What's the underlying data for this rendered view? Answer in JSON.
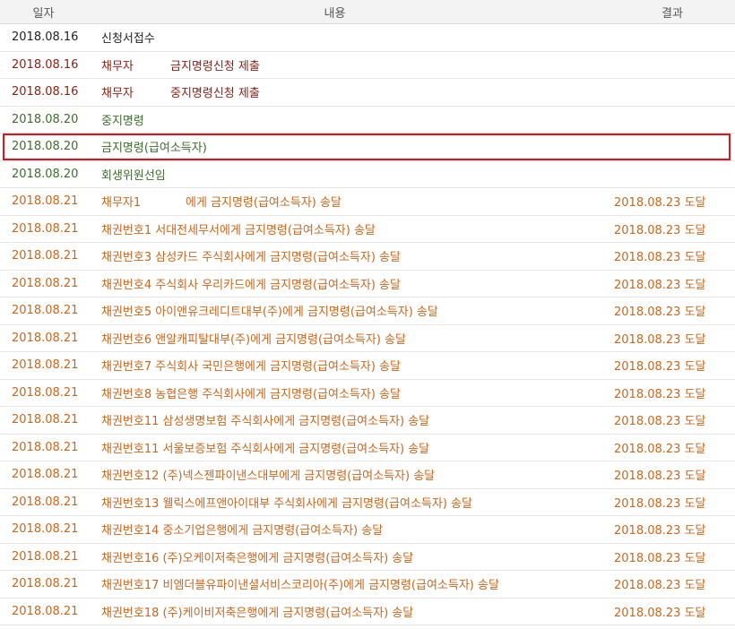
{
  "header": {
    "date": "일자",
    "content": "내용",
    "result": "결과"
  },
  "colors": {
    "black": "#222222",
    "maroon": "#8a1f11",
    "green": "#3f6b2f",
    "orange": "#c8661e",
    "highlight_border": "#e3111a"
  },
  "rows": [
    {
      "date": "2018.08.16",
      "party": "",
      "content": "신청서접수",
      "result": "",
      "color": "#222222",
      "highlight": false
    },
    {
      "date": "2018.08.16",
      "party": "채무자",
      "content": "금지명령신청 제출",
      "result": "",
      "color": "#8a1f11",
      "highlight": false
    },
    {
      "date": "2018.08.16",
      "party": "채무자",
      "content": "중지명령신청 제출",
      "result": "",
      "color": "#8a1f11",
      "highlight": false
    },
    {
      "date": "2018.08.20",
      "party": "",
      "content": "중지명령",
      "result": "",
      "color": "#3f6b2f",
      "highlight": false
    },
    {
      "date": "2018.08.20",
      "party": "",
      "content": "금지명령(급여소득자)",
      "result": "",
      "color": "#3f6b2f",
      "highlight": true
    },
    {
      "date": "2018.08.20",
      "party": "",
      "content": "회생위원선임",
      "result": "",
      "color": "#3f6b2f",
      "highlight": false
    },
    {
      "date": "2018.08.21",
      "party": "채무자1",
      "content": "에게 금지명령(급여소득자) 송달",
      "result": "2018.08.23 도달",
      "color": "#c8661e",
      "highlight": false
    },
    {
      "date": "2018.08.21",
      "party": "",
      "content": "채권번호1 서대전세무서에게 금지명령(급여소득자) 송달",
      "result": "2018.08.23 도달",
      "color": "#c8661e",
      "highlight": false
    },
    {
      "date": "2018.08.21",
      "party": "",
      "content": "채권번호3 삼성카드 주식회사에게 금지명령(급여소득자) 송달",
      "result": "2018.08.23 도달",
      "color": "#c8661e",
      "highlight": false
    },
    {
      "date": "2018.08.21",
      "party": "",
      "content": "채권번호4 주식회사 우리카드에게 금지명령(급여소득자) 송달",
      "result": "2018.08.23 도달",
      "color": "#c8661e",
      "highlight": false
    },
    {
      "date": "2018.08.21",
      "party": "",
      "content": "채권번호5 아이앤유크레디트대부(주)에게 금지명령(급여소득자) 송달",
      "result": "2018.08.23 도달",
      "color": "#c8661e",
      "highlight": false
    },
    {
      "date": "2018.08.21",
      "party": "",
      "content": "채권번호6 앤알캐피탈대부(주)에게 금지명령(급여소득자) 송달",
      "result": "2018.08.23 도달",
      "color": "#c8661e",
      "highlight": false
    },
    {
      "date": "2018.08.21",
      "party": "",
      "content": "채권번호7 주식회사 국민은행에게 금지명령(급여소득자) 송달",
      "result": "2018.08.23 도달",
      "color": "#c8661e",
      "highlight": false
    },
    {
      "date": "2018.08.21",
      "party": "",
      "content": "채권번호8 농협은행 주식회사에게 금지명령(급여소득자) 송달",
      "result": "2018.08.23 도달",
      "color": "#c8661e",
      "highlight": false
    },
    {
      "date": "2018.08.21",
      "party": "",
      "content": "채권번호11 삼성생명보험 주식회사에게 금지명령(급여소득자) 송달",
      "result": "2018.08.23 도달",
      "color": "#c8661e",
      "highlight": false
    },
    {
      "date": "2018.08.21",
      "party": "",
      "content": "채권번호11 서울보증보험 주식회사에게 금지명령(급여소득자) 송달",
      "result": "2018.08.23 도달",
      "color": "#c8661e",
      "highlight": false
    },
    {
      "date": "2018.08.21",
      "party": "",
      "content": "채권번호12 (주)넥스젠파이낸스대부에게 금지명령(급여소득자) 송달",
      "result": "2018.08.23 도달",
      "color": "#c8661e",
      "highlight": false
    },
    {
      "date": "2018.08.21",
      "party": "",
      "content": "채권번호13 웰릭스에프앤아이대부 주식회사에게 금지명령(급여소득자) 송달",
      "result": "2018.08.23 도달",
      "color": "#c8661e",
      "highlight": false
    },
    {
      "date": "2018.08.21",
      "party": "",
      "content": "채권번호14 중소기업은행에게 금지명령(급여소득자) 송달",
      "result": "2018.08.23 도달",
      "color": "#c8661e",
      "highlight": false
    },
    {
      "date": "2018.08.21",
      "party": "",
      "content": "채권번호16 (주)오케이저축은행에게 금지명령(급여소득자) 송달",
      "result": "2018.08.23 도달",
      "color": "#c8661e",
      "highlight": false
    },
    {
      "date": "2018.08.21",
      "party": "",
      "content": "채권번호17 비엠더블유파이낸셜서비스코리아(주)에게 금지명령(급여소득자) 송달",
      "result": "2018.08.23 도달",
      "color": "#c8661e",
      "highlight": false
    },
    {
      "date": "2018.08.21",
      "party": "",
      "content": "채권번호18 (주)케이비저축은행에게 금지명령(급여소득자) 송달",
      "result": "2018.08.23 도달",
      "color": "#c8661e",
      "highlight": false
    }
  ]
}
